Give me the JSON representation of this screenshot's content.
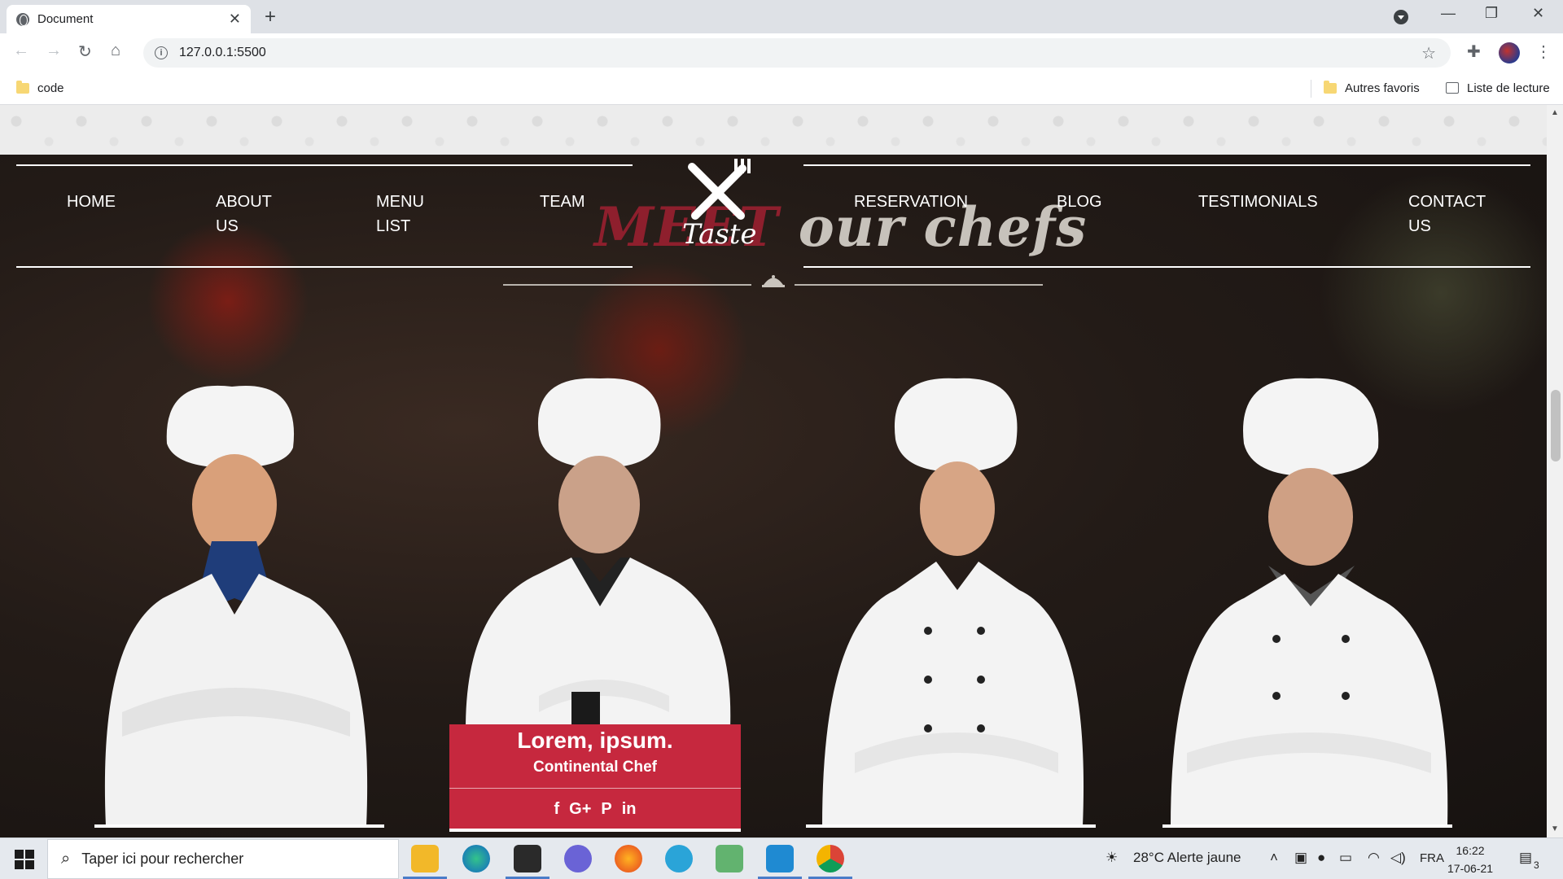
{
  "browser": {
    "tab_title": "Document",
    "new_tab": "+",
    "url": "127.0.0.1:5500",
    "bookmarks": {
      "left": "code",
      "other": "Autres favoris",
      "reading_list": "Liste de lecture"
    }
  },
  "nav": {
    "items": [
      "HOME",
      "ABOUT US",
      "MENU LIST",
      "TEAM",
      "RESERVATION",
      "BLOG",
      "TESTIMONIALS",
      "CONTACT US"
    ],
    "about": [
      "ABOUT",
      "US"
    ],
    "menu": [
      "MENU",
      "LIST"
    ],
    "contact": [
      "CONTACT",
      "US"
    ],
    "logo_text": "Taste"
  },
  "section": {
    "heading_red": "MEET",
    "heading_rest": "our chefs"
  },
  "chef_card": {
    "name": "Lorem, ipsum.",
    "role": "Continental Chef",
    "social": [
      "f",
      "G+",
      "P",
      "in"
    ]
  },
  "taskbar": {
    "search_placeholder": "Taper ici pour rechercher",
    "weather": "28°C  Alerte jaune",
    "lang": "FRA",
    "time": "16:22",
    "date": "17-06-21",
    "notifications": "3"
  },
  "colors": {
    "accent_red": "#c6283e",
    "heading_red": "#8e1f2d"
  }
}
